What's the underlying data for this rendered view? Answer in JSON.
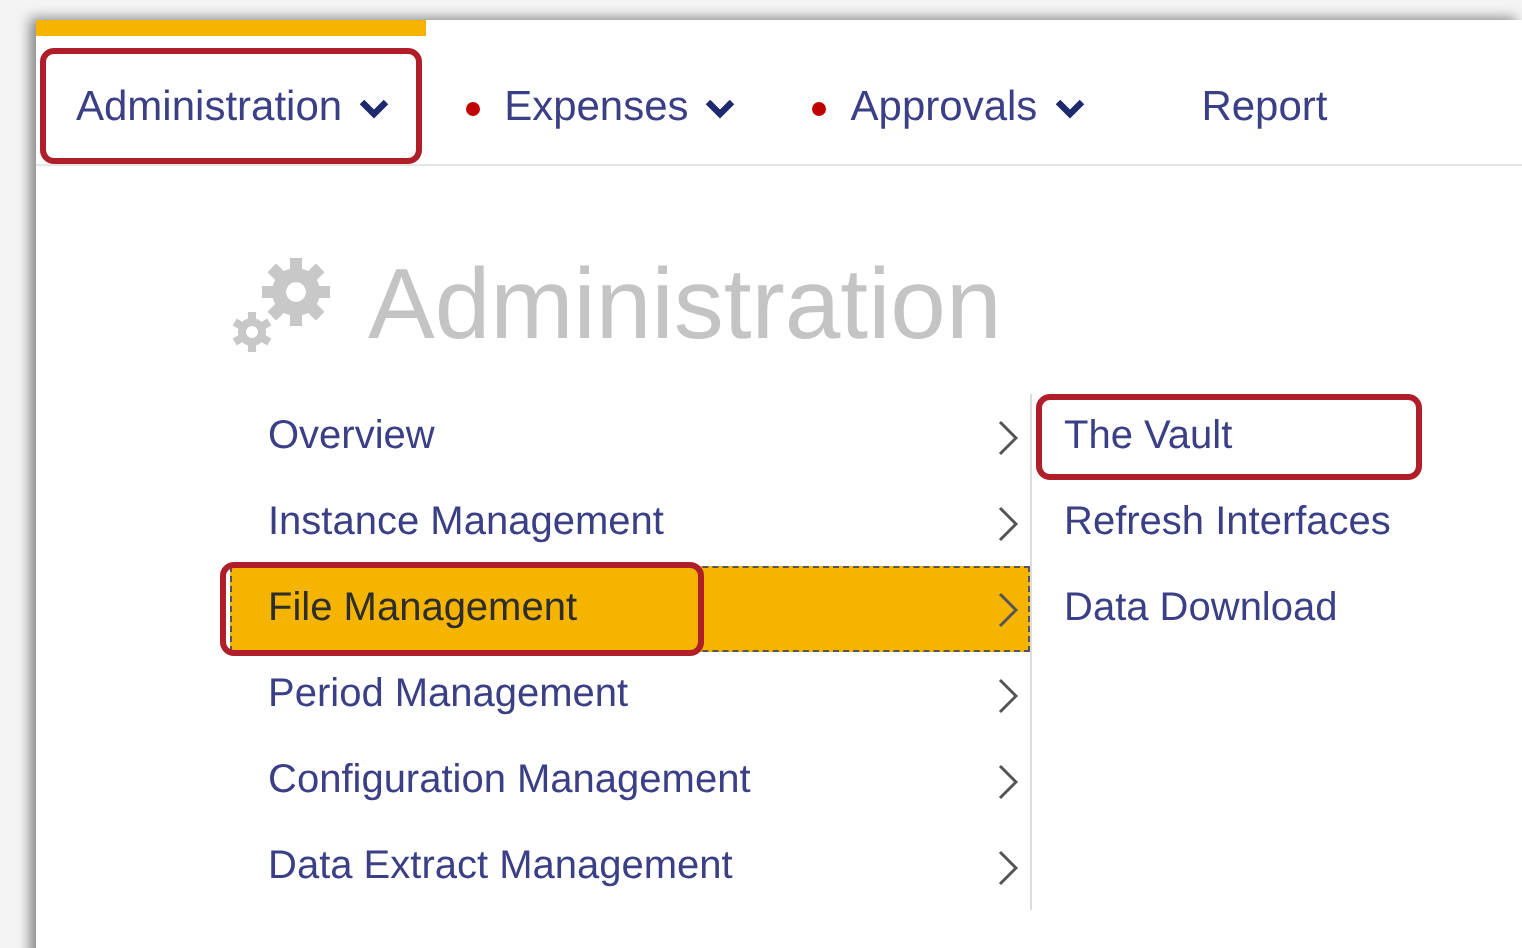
{
  "nav_tabs": [
    {
      "label": "Administration",
      "selected": true,
      "dot": false,
      "dropdown": true,
      "annotated": true
    },
    {
      "label": "Expenses",
      "selected": false,
      "dot": true,
      "dropdown": true,
      "annotated": false
    },
    {
      "label": "Approvals",
      "selected": false,
      "dot": true,
      "dropdown": true,
      "annotated": false
    },
    {
      "label": "Report",
      "selected": false,
      "dot": false,
      "dropdown": false,
      "annotated": false
    }
  ],
  "heading": "Administration",
  "menu": [
    {
      "label": "Overview",
      "selected": false,
      "annotated": false
    },
    {
      "label": "Instance Management",
      "selected": false,
      "annotated": false
    },
    {
      "label": "File Management",
      "selected": true,
      "annotated": true
    },
    {
      "label": "Period Management",
      "selected": false,
      "annotated": false
    },
    {
      "label": "Configuration Management",
      "selected": false,
      "annotated": false
    },
    {
      "label": "Data Extract Management",
      "selected": false,
      "annotated": false
    }
  ],
  "submenu": [
    {
      "label": "The Vault",
      "annotated": true
    },
    {
      "label": "Refresh Interfaces",
      "annotated": false
    },
    {
      "label": "Data Download",
      "annotated": false
    }
  ]
}
